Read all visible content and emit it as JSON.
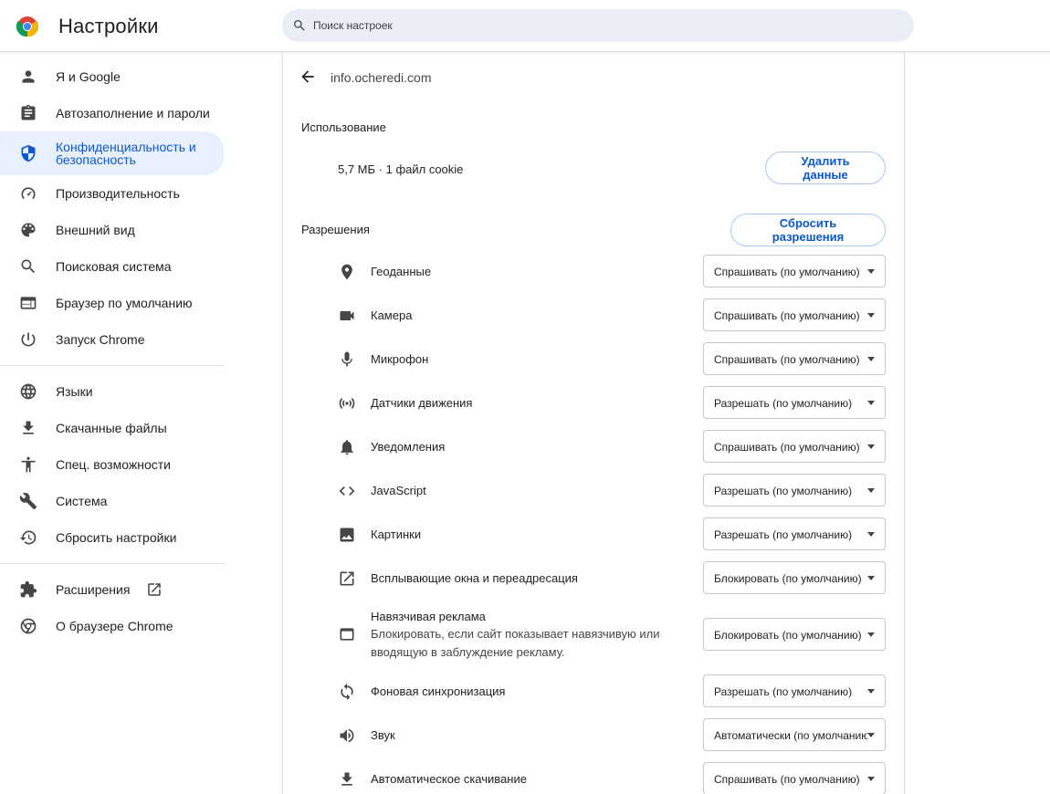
{
  "header": {
    "title": "Настройки",
    "search_placeholder": "Поиск настроек",
    "search_value": ""
  },
  "sidebar": {
    "items": [
      {
        "label": "Я и Google",
        "icon": "person-icon"
      },
      {
        "label": "Автозаполнение и пароли",
        "icon": "clipboard-icon"
      },
      {
        "label": "Конфиденциальность и безопасность",
        "icon": "shield-icon",
        "active": true
      },
      {
        "label": "Производительность",
        "icon": "speedometer-icon"
      },
      {
        "label": "Внешний вид",
        "icon": "palette-icon"
      },
      {
        "label": "Поисковая система",
        "icon": "search-icon"
      },
      {
        "label": "Браузер по умолчанию",
        "icon": "browser-window-icon"
      },
      {
        "label": "Запуск Chrome",
        "icon": "power-icon"
      },
      {
        "label": "Языки",
        "icon": "globe-icon"
      },
      {
        "label": "Скачанные файлы",
        "icon": "download-icon"
      },
      {
        "label": "Спец. возможности",
        "icon": "accessibility-icon"
      },
      {
        "label": "Система",
        "icon": "wrench-icon"
      },
      {
        "label": "Сбросить настройки",
        "icon": "history-icon"
      },
      {
        "label": "Расширения",
        "icon": "puzzle-icon"
      },
      {
        "label": "О браузере Chrome",
        "icon": "chrome-icon"
      }
    ]
  },
  "site": {
    "name": "info.ocheredi.com",
    "usage_title": "Использование",
    "usage_text": "5,7 МБ · 1 файл cookie",
    "delete_button": "Удалить данные",
    "permissions_title": "Разрешения",
    "reset_button": "Сбросить разрешения"
  },
  "permissions": [
    {
      "label": "Геоданные",
      "value": "Спрашивать (по умолчанию)",
      "icon": "location-pin-icon"
    },
    {
      "label": "Камера",
      "value": "Спрашивать (по умолчанию)",
      "icon": "camera-icon"
    },
    {
      "label": "Микрофон",
      "value": "Спрашивать (по умолчанию)",
      "icon": "microphone-icon"
    },
    {
      "label": "Датчики движения",
      "value": "Разрешать (по умолчанию)",
      "icon": "sensors-icon"
    },
    {
      "label": "Уведомления",
      "value": "Спрашивать (по умолчанию)",
      "icon": "bell-icon"
    },
    {
      "label": "JavaScript",
      "value": "Разрешать (по умолчанию)",
      "icon": "code-icon"
    },
    {
      "label": "Картинки",
      "value": "Разрешать (по умолчанию)",
      "icon": "image-icon"
    },
    {
      "label": "Всплывающие окна и переадресация",
      "value": "Блокировать (по умолчанию)",
      "icon": "open-in-new-icon"
    },
    {
      "label": "Навязчивая реклама",
      "sublabel": "Блокировать, если сайт показывает навязчивую или вводящую в заблуждение рекламу.",
      "value": "Блокировать (по умолчанию)",
      "icon": "ad-window-icon"
    },
    {
      "label": "Фоновая синхронизация",
      "value": "Разрешать (по умолчанию)",
      "icon": "sync-icon"
    },
    {
      "label": "Звук",
      "value": "Автоматически (по умолчанию)",
      "icon": "speaker-icon"
    },
    {
      "label": "Автоматическое скачивание",
      "value": "Спрашивать (по умолчанию)",
      "icon": "download-icon"
    }
  ]
}
